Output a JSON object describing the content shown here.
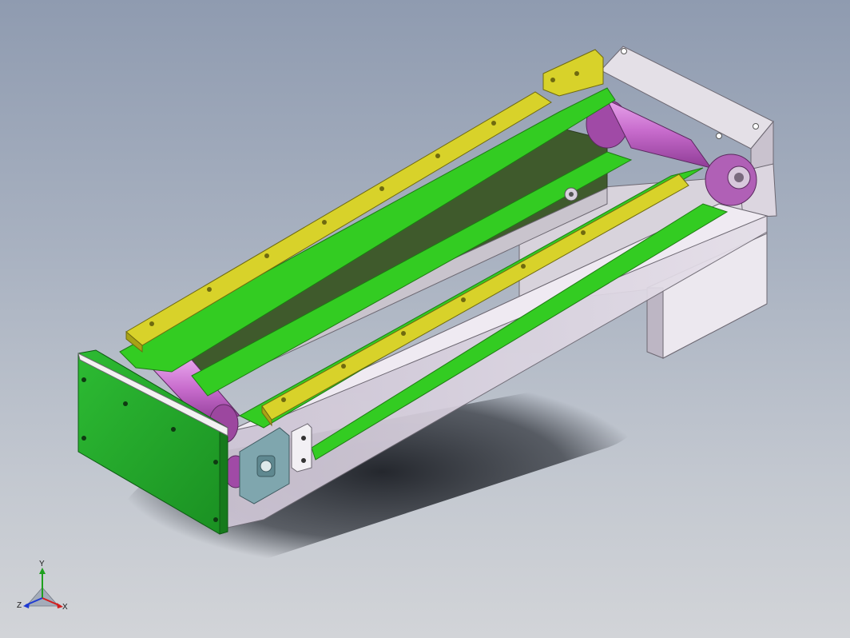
{
  "viewport": {
    "background_top": "#8f9bb0",
    "background_bottom": "#d2d4d8"
  },
  "model": {
    "name": "",
    "colors": {
      "end_plate": "#22a52a",
      "belt": "#33cc22",
      "guide_rail": "#c9c320",
      "roller": "#c86ccd",
      "frame": "#d9d2de",
      "bracket": "#7fa6ae",
      "shadow": "#2b2f36"
    }
  },
  "triad": {
    "x_label": "X",
    "y_label": "Y",
    "z_label": "Z",
    "x_color": "#d21e1e",
    "y_color": "#1ea01e",
    "z_color": "#1e3ad2"
  }
}
